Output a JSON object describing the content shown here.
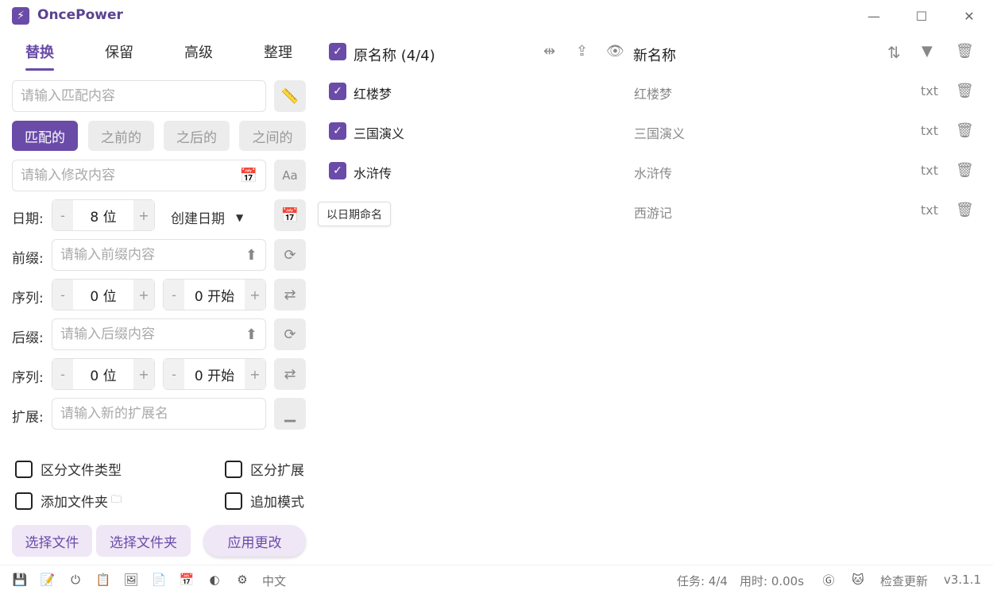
{
  "app": {
    "title": "OncePower"
  },
  "tabs": [
    {
      "label": "替换",
      "active": true
    },
    {
      "label": "保留"
    },
    {
      "label": "高级"
    },
    {
      "label": "整理"
    }
  ],
  "replace": {
    "match_placeholder": "请输入匹配内容",
    "modes": [
      "匹配的",
      "之前的",
      "之后的",
      "之间的"
    ],
    "modify_placeholder": "请输入修改内容"
  },
  "date": {
    "label": "日期:",
    "digits": "8 位",
    "type": "创建日期",
    "tooltip": "以日期命名"
  },
  "prefix": {
    "label": "前缀:",
    "placeholder": "请输入前缀内容"
  },
  "prefix_seq": {
    "label": "序列:",
    "digits": "0 位",
    "start": "0 开始"
  },
  "suffix": {
    "label": "后缀:",
    "placeholder": "请输入后缀内容"
  },
  "suffix_seq": {
    "label": "序列:",
    "digits": "0 位",
    "start": "0 开始"
  },
  "ext": {
    "label": "扩展:",
    "placeholder": "请输入新的扩展名"
  },
  "options": {
    "distinguish_type": "区分文件类型",
    "distinguish_ext": "区分扩展",
    "add_folder": "添加文件夹",
    "append_mode": "追加模式"
  },
  "actions": {
    "select_files": "选择文件",
    "select_folder": "选择文件夹",
    "apply": "应用更改"
  },
  "list": {
    "original_header": "原名称 (4/4)",
    "new_header": "新名称",
    "rows": [
      {
        "name": "红楼梦",
        "new": "红楼梦",
        "ext": "txt",
        "checked": true
      },
      {
        "name": "三国演义",
        "new": "三国演义",
        "ext": "txt",
        "checked": true
      },
      {
        "name": "水浒传",
        "new": "水浒传",
        "ext": "txt",
        "checked": true
      },
      {
        "name": "",
        "new": "西游记",
        "ext": "txt",
        "checked": false
      }
    ]
  },
  "status": {
    "language": "中文",
    "tasks": "任务: 4/4",
    "time": "用时: 0.00s",
    "check_update": "检查更新",
    "version": "v3.1.1"
  },
  "colors": {
    "accent": "#6a4ba8",
    "accent_light": "#efe6f6"
  }
}
